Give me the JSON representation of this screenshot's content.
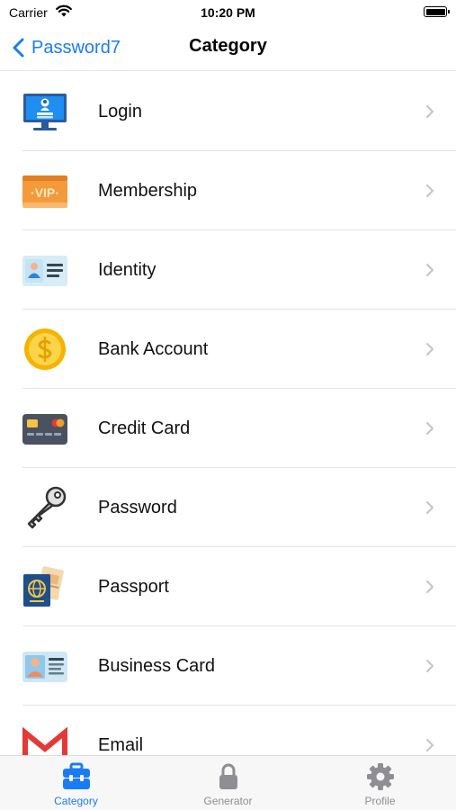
{
  "status_bar": {
    "carrier": "Carrier",
    "time": "10:20 PM"
  },
  "nav": {
    "back_label": "Password7",
    "title": "Category"
  },
  "categories": [
    {
      "label": "Login",
      "icon": "computer-login-icon"
    },
    {
      "label": "Membership",
      "icon": "vip-card-icon"
    },
    {
      "label": "Identity",
      "icon": "id-card-icon"
    },
    {
      "label": "Bank Account",
      "icon": "dollar-coin-icon"
    },
    {
      "label": "Credit Card",
      "icon": "credit-card-icon"
    },
    {
      "label": "Password",
      "icon": "key-icon"
    },
    {
      "label": "Passport",
      "icon": "passport-icon"
    },
    {
      "label": "Business Card",
      "icon": "business-card-icon"
    },
    {
      "label": "Email",
      "icon": "gmail-icon"
    }
  ],
  "vip_text": "·VIP·",
  "tabs": [
    {
      "label": "Category",
      "icon": "toolbox-icon",
      "active": true
    },
    {
      "label": "Generator",
      "icon": "lock-icon",
      "active": false
    },
    {
      "label": "Profile",
      "icon": "gear-icon",
      "active": false
    }
  ],
  "colors": {
    "accent": "#1a7cf5",
    "inactive": "#8e8e93"
  }
}
